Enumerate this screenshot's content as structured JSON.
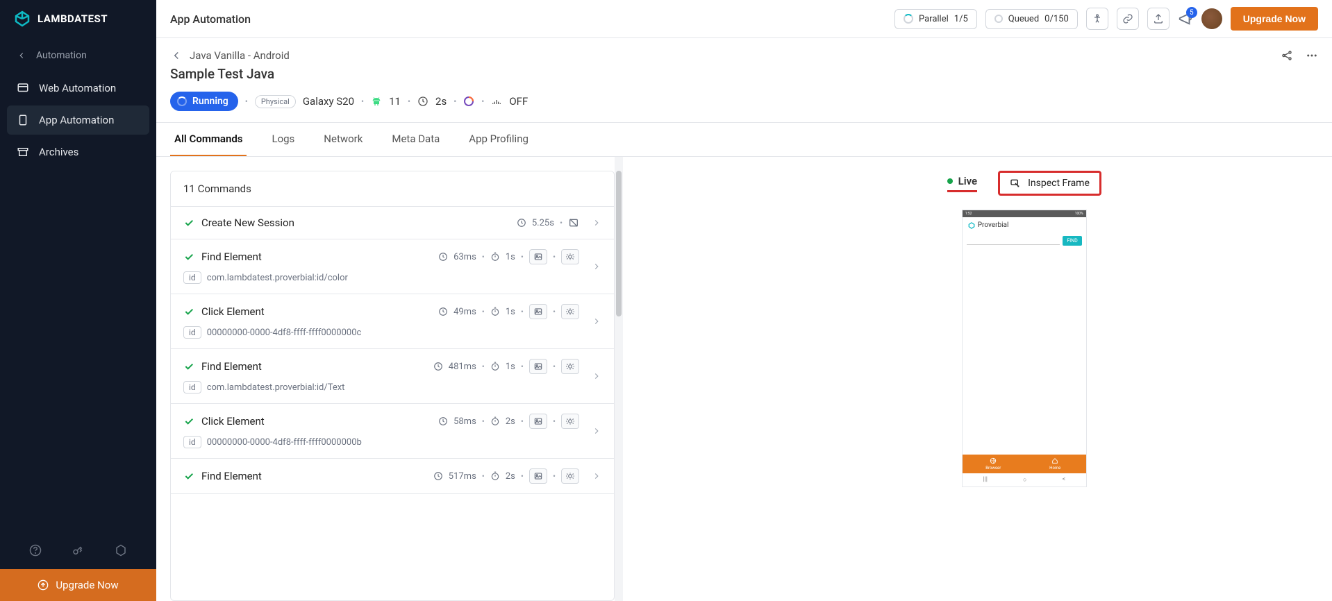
{
  "brand": "LAMBDATEST",
  "sidebar": {
    "back_label": "Automation",
    "items": [
      "Web Automation",
      "App Automation",
      "Archives"
    ],
    "active_index": 1,
    "upgrade_label": "Upgrade Now"
  },
  "topbar": {
    "title": "App Automation",
    "parallel_label": "Parallel",
    "parallel_value": "1/5",
    "queued_label": "Queued",
    "queued_value": "0/150",
    "notif_count": "5",
    "upgrade_button": "Upgrade Now"
  },
  "breadcrumb": {
    "path": "Java Vanilla - Android",
    "session_name": "Sample Test Java"
  },
  "status": {
    "state": "Running",
    "physical_tag": "Physical",
    "device": "Galaxy S20",
    "os_version": "11",
    "duration": "2s",
    "toggle": "OFF"
  },
  "tabs": [
    "All Commands",
    "Logs",
    "Network",
    "Meta Data",
    "App Profiling"
  ],
  "commands": {
    "count_label": "11 Commands",
    "items": [
      {
        "name": "Create New Session",
        "time": "5.25s",
        "wait": null,
        "id_label": null,
        "id_value": null,
        "has_screenshot_disabled": true,
        "has_debug": false
      },
      {
        "name": "Find Element",
        "time": "63ms",
        "wait": "1s",
        "id_label": "id",
        "id_value": "com.lambdatest.proverbial:id/color",
        "has_debug": true
      },
      {
        "name": "Click Element",
        "time": "49ms",
        "wait": "1s",
        "id_label": "id",
        "id_value": "00000000-0000-4df8-ffff-ffff0000000c",
        "has_debug": true
      },
      {
        "name": "Find Element",
        "time": "481ms",
        "wait": "1s",
        "id_label": "id",
        "id_value": "com.lambdatest.proverbial:id/Text",
        "has_debug": true
      },
      {
        "name": "Click Element",
        "time": "58ms",
        "wait": "2s",
        "id_label": "id",
        "id_value": "00000000-0000-4df8-ffff-ffff0000000b",
        "has_debug": true
      },
      {
        "name": "Find Element",
        "time": "517ms",
        "wait": "2s",
        "id_label": null,
        "id_value": null,
        "has_debug": true
      }
    ]
  },
  "preview": {
    "live_label": "Live",
    "inspect_label": "Inspect Frame",
    "device": {
      "status_time": "1:52",
      "status_right": "100%",
      "app_name": "Proverbial",
      "find_label": "FIND",
      "tab1": "Browser",
      "tab2": "Home"
    }
  }
}
